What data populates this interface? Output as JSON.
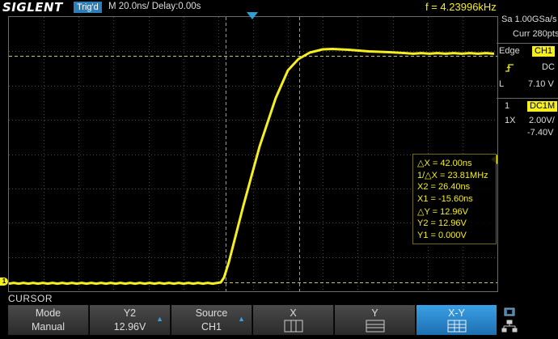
{
  "header": {
    "logo": "SIGLENT",
    "trigger_state": "Trig'd",
    "timebase_text": "M 20.0ns/  Delay:0.00s",
    "frequency": "f = 4.23996kHz"
  },
  "acquisition": {
    "sample_rate": "Sa 1.00GSa/s",
    "memory": "Curr 280pts"
  },
  "trigger": {
    "type": "Edge",
    "source": "CH1",
    "slope_icon": "rising-edge-icon",
    "coupling": "DC",
    "level_label": "L",
    "level": "7.10 V"
  },
  "channel1": {
    "number": "1",
    "coupling": "DC1M",
    "probe": "1X",
    "scale": "2.00V/",
    "offset": "-7.40V",
    "ground_marker": "1",
    "color": "#f5ef20"
  },
  "cursor_readout": {
    "delta_x": "△X = 42.00ns",
    "inv_delta_x": "1/△X = 23.81MHz",
    "x2": "X2 = 26.40ns",
    "x1": "X1 = -15.60ns",
    "delta_y": "△Y = 12.96V",
    "y2": "Y2 = 12.96V",
    "y1": "Y1 = 0.000V"
  },
  "menu": {
    "title": "CURSOR",
    "keys": [
      {
        "line1": "Mode",
        "line2": "Manual"
      },
      {
        "line1": "Y2",
        "line2": "12.96V"
      },
      {
        "line1": "Source",
        "line2": "CH1"
      },
      {
        "line1": "X",
        "icon": "x-cursor-icon"
      },
      {
        "line1": "Y",
        "icon": "y-cursor-icon"
      },
      {
        "line1": "X-Y",
        "icon": "xy-cursor-icon"
      }
    ]
  },
  "colors": {
    "trace": "#f5ef20",
    "accent": "#2c7fb8",
    "grid": "#5a5a5a"
  }
}
